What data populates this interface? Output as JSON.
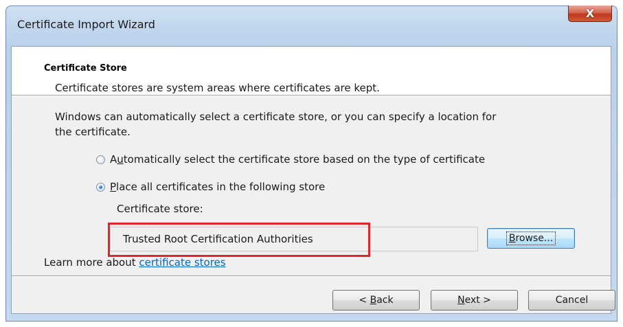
{
  "window": {
    "title": "Certificate Import Wizard",
    "close_icon": "close-icon",
    "close_glyph": "X"
  },
  "header": {
    "title": "Certificate Store",
    "subtitle": "Certificate stores are system areas where certificates are kept."
  },
  "body": {
    "intro_line1": "Windows can automatically select a certificate store, or you can specify a location for",
    "intro_line2": "the certificate.",
    "radio_auto": {
      "label_prefix": "A",
      "label_mnemonic": "u",
      "label_rest": "tomatically select the certificate store based on the type of certificate",
      "selected": false
    },
    "radio_place": {
      "label_mnemonic": "P",
      "label_rest": "lace all certificates in the following store",
      "selected": true
    },
    "store_label": "Certificate store:",
    "store_value": "Trusted Root Certification Authorities",
    "browse_mnemonic": "B",
    "browse_rest": "rowse...",
    "learn_more_prefix": "Learn more about ",
    "learn_more_link": "certificate stores"
  },
  "footer": {
    "back_prefix": "< ",
    "back_mnemonic": "B",
    "back_rest": "ack",
    "next_mnemonic": "N",
    "next_rest": "ext >",
    "cancel_label": "Cancel"
  },
  "colors": {
    "highlight_border": "#e0262a",
    "link": "#0066cc",
    "close_button": "#c0381f"
  }
}
